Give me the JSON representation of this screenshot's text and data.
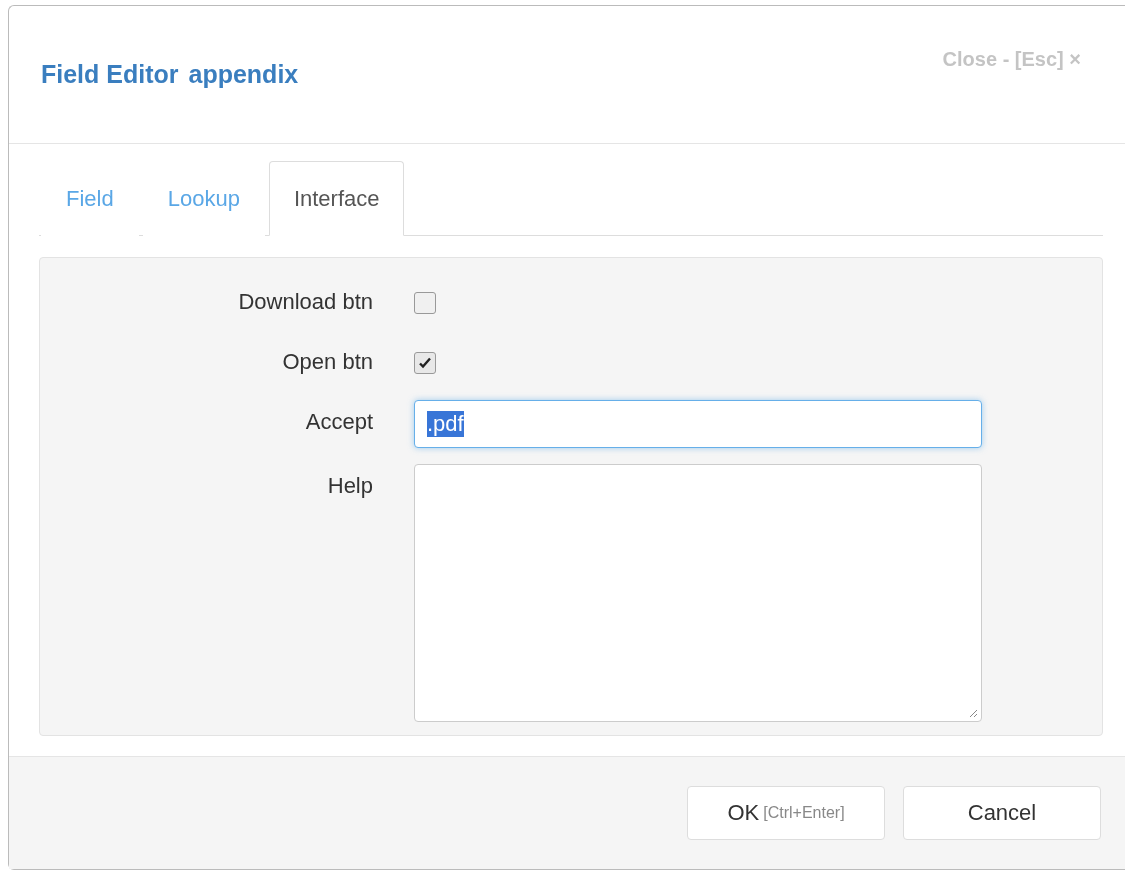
{
  "dialog": {
    "title": "Field Editor",
    "subtitle": "appendix",
    "close": "Close - [Esc] ×"
  },
  "tabs": [
    {
      "label": "Field",
      "selected": false
    },
    {
      "label": "Lookup",
      "selected": false
    },
    {
      "label": "Interface",
      "selected": true
    }
  ],
  "form": [
    {
      "kind": "checkbox",
      "label": "Download btn",
      "checked": false
    },
    {
      "kind": "checkbox",
      "label": "Open btn",
      "checked": true
    },
    {
      "kind": "input",
      "label": "Accept",
      "value": ".pdf"
    },
    {
      "kind": "textarea",
      "label": "Help"
    }
  ],
  "buttons": [
    {
      "label": "OK",
      "hint": "[Ctrl+Enter]"
    },
    {
      "label": "Cancel"
    }
  ]
}
